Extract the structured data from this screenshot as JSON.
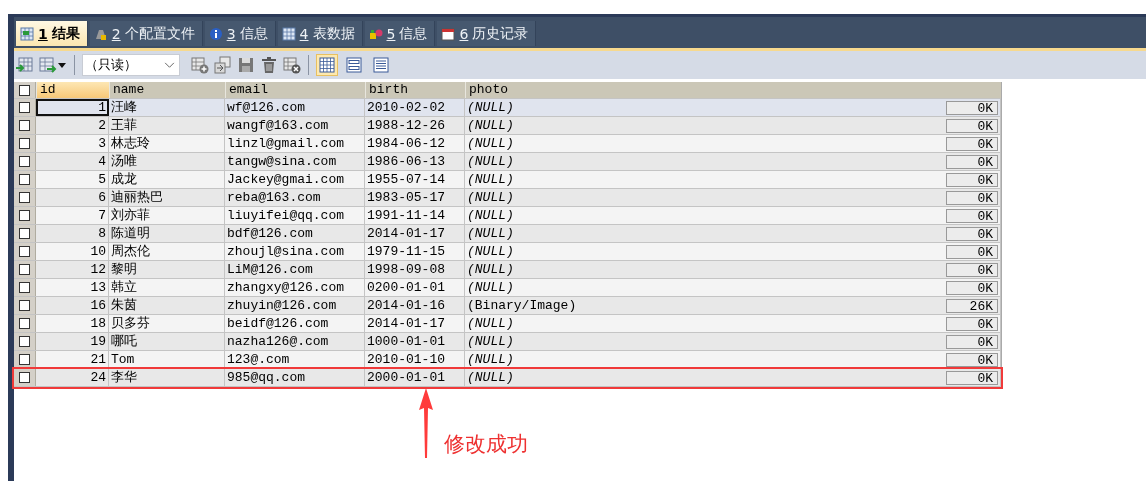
{
  "tabs": [
    {
      "number": "1",
      "label": "结果",
      "selected": true
    },
    {
      "number": "2",
      "label": "个配置文件",
      "selected": false
    },
    {
      "number": "3",
      "label": "信息",
      "selected": false
    },
    {
      "number": "4",
      "label": "表数据",
      "selected": false
    },
    {
      "number": "5",
      "label": "信息",
      "selected": false
    },
    {
      "number": "6",
      "label": "历史记录",
      "selected": false
    }
  ],
  "toolbar": {
    "mode_dropdown": "（只读）",
    "views": [
      {
        "kind": "grid",
        "selected": true
      },
      {
        "kind": "form",
        "selected": false
      },
      {
        "kind": "text",
        "selected": false
      }
    ]
  },
  "table": {
    "select_all_checked": false,
    "columns": [
      "id",
      "name",
      "email",
      "birth",
      "photo"
    ],
    "rows": [
      {
        "kind": "null",
        "checked": false,
        "selected": true,
        "marked": false,
        "id": "1",
        "name": "汪峰",
        "email": "wf@126.com",
        "birth": "2010-02-02",
        "photo": "(NULL)",
        "size": "0K"
      },
      {
        "kind": "null",
        "checked": false,
        "selected": false,
        "marked": false,
        "id": "2",
        "name": "王菲",
        "email": "wangf@163.com",
        "birth": "1988-12-26",
        "photo": "(NULL)",
        "size": "0K"
      },
      {
        "kind": "null",
        "checked": false,
        "selected": false,
        "marked": false,
        "id": "3",
        "name": "林志玲",
        "email": "linzl@gmail.com",
        "birth": "1984-06-12",
        "photo": "(NULL)",
        "size": "0K"
      },
      {
        "kind": "null",
        "checked": false,
        "selected": false,
        "marked": false,
        "id": "4",
        "name": "汤唯",
        "email": "tangw@sina.com",
        "birth": "1986-06-13",
        "photo": "(NULL)",
        "size": "0K"
      },
      {
        "kind": "null",
        "checked": false,
        "selected": false,
        "marked": false,
        "id": "5",
        "name": "成龙",
        "email": "Jackey@gmai.com",
        "birth": "1955-07-14",
        "photo": "(NULL)",
        "size": "0K"
      },
      {
        "kind": "null",
        "checked": false,
        "selected": false,
        "marked": false,
        "id": "6",
        "name": "迪丽热巴",
        "email": "reba@163.com",
        "birth": "1983-05-17",
        "photo": "(NULL)",
        "size": "0K"
      },
      {
        "kind": "null",
        "checked": false,
        "selected": false,
        "marked": false,
        "id": "7",
        "name": "刘亦菲",
        "email": "liuyifei@qq.com",
        "birth": "1991-11-14",
        "photo": "(NULL)",
        "size": "0K"
      },
      {
        "kind": "null",
        "checked": false,
        "selected": false,
        "marked": false,
        "id": "8",
        "name": "陈道明",
        "email": "bdf@126.com",
        "birth": "2014-01-17",
        "photo": "(NULL)",
        "size": "0K"
      },
      {
        "kind": "null",
        "checked": false,
        "selected": false,
        "marked": false,
        "id": "10",
        "name": "周杰伦",
        "email": "zhoujl@sina.com",
        "birth": "1979-11-15",
        "photo": "(NULL)",
        "size": "0K"
      },
      {
        "kind": "null",
        "checked": false,
        "selected": false,
        "marked": false,
        "id": "12",
        "name": "黎明",
        "email": "LiM@126.com",
        "birth": "1998-09-08",
        "photo": "(NULL)",
        "size": "0K"
      },
      {
        "kind": "null",
        "checked": false,
        "selected": false,
        "marked": false,
        "id": "13",
        "name": "韩立",
        "email": "zhangxy@126.com",
        "birth": "0200-01-01",
        "photo": "(NULL)",
        "size": "0K"
      },
      {
        "kind": "binary",
        "checked": false,
        "selected": false,
        "marked": false,
        "id": "16",
        "name": "朱茵",
        "email": "zhuyin@126.com",
        "birth": "2014-01-16",
        "photo": "(Binary/Image)",
        "size": "26K"
      },
      {
        "kind": "null",
        "checked": false,
        "selected": false,
        "marked": false,
        "id": "18",
        "name": "贝多芬",
        "email": "beidf@126.com",
        "birth": "2014-01-17",
        "photo": "(NULL)",
        "size": "0K"
      },
      {
        "kind": "null",
        "checked": false,
        "selected": false,
        "marked": false,
        "id": "19",
        "name": "哪吒",
        "email": "nazha126@.com",
        "birth": "1000-01-01",
        "photo": "(NULL)",
        "size": "0K"
      },
      {
        "kind": "null",
        "checked": false,
        "selected": false,
        "marked": false,
        "id": "21",
        "name": "Tom",
        "email": "123@.com",
        "birth": "2010-01-10",
        "photo": "(NULL)",
        "size": "0K"
      },
      {
        "kind": "null",
        "checked": false,
        "selected": false,
        "marked": true,
        "id": "24",
        "name": "李华",
        "email": "985@qq.com",
        "birth": "2000-01-01",
        "photo": "(NULL)",
        "size": "0K"
      }
    ]
  },
  "annotation": {
    "text": "修改成功"
  }
}
